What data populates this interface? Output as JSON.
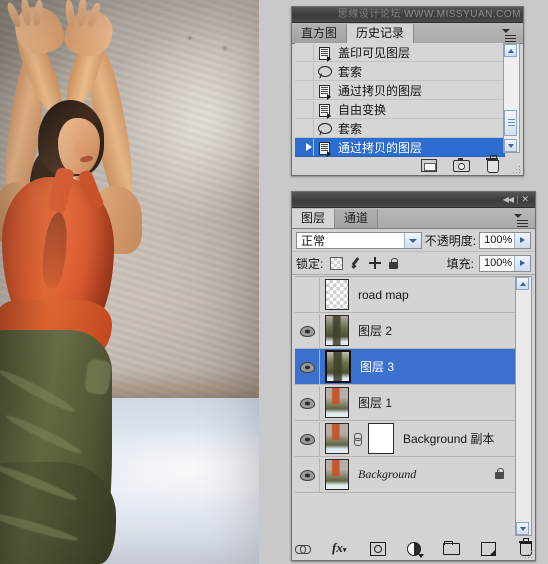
{
  "app": {
    "watermark_cn": "思缘设计论坛",
    "watermark_url": "WWW.MISSYUAN.COM"
  },
  "history_panel": {
    "tabs": [
      {
        "label": "直方图",
        "active": false
      },
      {
        "label": "历史记录",
        "active": true
      }
    ],
    "menu_icon": "panel-menu-icon",
    "rows": [
      {
        "label": "盖印可见图层",
        "icon": "document-state-icon",
        "selected": false,
        "marker": false
      },
      {
        "label": "套索",
        "icon": "lasso-tool-icon",
        "selected": false,
        "marker": false
      },
      {
        "label": "通过拷贝的图层",
        "icon": "document-state-icon",
        "selected": false,
        "marker": false
      },
      {
        "label": "自由变换",
        "icon": "document-state-icon",
        "selected": false,
        "marker": false
      },
      {
        "label": "套索",
        "icon": "lasso-tool-icon",
        "selected": false,
        "marker": false
      },
      {
        "label": "通过拷贝的图层",
        "icon": "document-state-icon",
        "selected": true,
        "marker": true
      }
    ],
    "footer_icons": [
      "new-document-from-state-icon",
      "new-snapshot-icon",
      "delete-state-icon"
    ],
    "scrollbar": {
      "up": "scroll-up-arrow-icon",
      "down": "scroll-down-arrow-icon",
      "thumb": "scroll-thumb"
    }
  },
  "layers_panel": {
    "collapse_icon": "collapse-to-icons-icon",
    "close_icon": "close-icon",
    "tabs": [
      {
        "label": "图层",
        "active": true
      },
      {
        "label": "通道",
        "active": false
      }
    ],
    "menu_icon": "panel-menu-icon",
    "blend_mode": {
      "value": "正常",
      "dropdown_icon": "chevron-down-icon"
    },
    "opacity": {
      "label": "不透明度:",
      "value": "100%",
      "stepper_icon": "stepper-arrow-icon"
    },
    "lock": {
      "label": "锁定:",
      "icons": [
        "lock-transparent-pixels-icon",
        "lock-image-pixels-icon",
        "lock-position-icon",
        "lock-all-icon"
      ]
    },
    "fill": {
      "label": "填充:",
      "value": "100%",
      "stepper_icon": "stepper-arrow-icon"
    },
    "rows": [
      {
        "name": "road map",
        "visible": false,
        "selected": false,
        "thumb": "checker",
        "has_mask": false,
        "has_link": false,
        "locked": false,
        "italic": false
      },
      {
        "name": "图层 2",
        "visible": true,
        "selected": false,
        "thumb": "figure",
        "has_mask": false,
        "has_link": false,
        "locked": false,
        "italic": false
      },
      {
        "name": "图层 3",
        "visible": true,
        "selected": true,
        "thumb": "figure",
        "has_mask": false,
        "has_link": false,
        "locked": false,
        "italic": false
      },
      {
        "name": "图层 1",
        "visible": true,
        "selected": false,
        "thumb": "photo",
        "has_mask": false,
        "has_link": false,
        "locked": false,
        "italic": false
      },
      {
        "name": "Background 副本",
        "visible": true,
        "selected": false,
        "thumb": "photo",
        "has_mask": true,
        "has_link": true,
        "locked": false,
        "italic": false
      },
      {
        "name": "Background",
        "visible": true,
        "selected": false,
        "thumb": "photo",
        "has_mask": false,
        "has_link": false,
        "locked": true,
        "italic": true
      }
    ],
    "footer_icons": [
      "link-layers-icon",
      "add-layer-style-icon",
      "add-layer-mask-icon",
      "new-adjustment-layer-icon",
      "new-group-icon",
      "new-layer-icon",
      "delete-layer-icon"
    ],
    "eye_icon": "visibility-eye-icon"
  },
  "canvas": {
    "description": "dancer-photo",
    "colors": {
      "top": "#d9522a",
      "skirt": "#4c5130",
      "wall": "#b6aea5",
      "floor": "#e2e9f2",
      "selection_blue": "#3b72cf"
    }
  }
}
